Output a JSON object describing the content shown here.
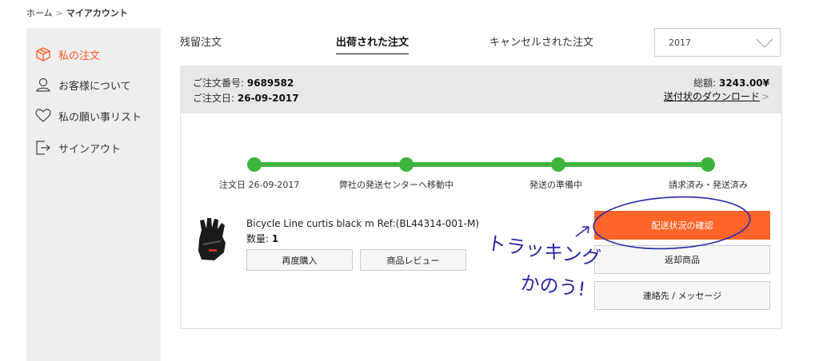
{
  "breadcrumb": {
    "home": "ホーム",
    "separator": ">",
    "current": "マイアカウント"
  },
  "sidebar": {
    "items": [
      {
        "label": "私の注文",
        "icon": "box-icon",
        "active": true
      },
      {
        "label": "お客様について",
        "icon": "user-icon",
        "active": false
      },
      {
        "label": "私の願い事リスト",
        "icon": "heart-icon",
        "active": false
      },
      {
        "label": "サインアウト",
        "icon": "signout-icon",
        "active": false
      }
    ]
  },
  "tabs": [
    {
      "label": "残留注文",
      "active": false
    },
    {
      "label": "出荷された注文",
      "active": true
    },
    {
      "label": "キャンセルされた注文",
      "active": false
    }
  ],
  "year_select": {
    "value": "2017",
    "icon": "chevron-down-icon"
  },
  "order": {
    "number_label": "ご注文番号:",
    "number": "9689582",
    "date_label": "ご注文日:",
    "date": "26-09-2017",
    "total_label": "総額:",
    "total": "3243.00¥",
    "download_label": "送付状のダウンロード",
    "download_chevron": ">"
  },
  "tracking": {
    "color": "#3fb43b",
    "steps": [
      {
        "label": "注文日 26-09-2017"
      },
      {
        "label": "弊社の発送センターへ移動中"
      },
      {
        "label": "発送の準備中"
      },
      {
        "label": "請求済み・発送済み"
      }
    ]
  },
  "product": {
    "name": "Bicycle Line curtis black m Ref:(BL44314-001-M)",
    "qty_label": "数量:",
    "qty": "1",
    "image_icon": "glove-icon"
  },
  "buttons": {
    "rebuy": "再度購入",
    "review": "商品レビュー",
    "track": "配送状況の確認",
    "return": "返却商品",
    "contact": "連絡先 / メッセージ"
  },
  "accent_color": "#ff6428",
  "annotation": {
    "line1": "トラッキング",
    "line2": "かのう!",
    "color": "#2a2aa8"
  }
}
